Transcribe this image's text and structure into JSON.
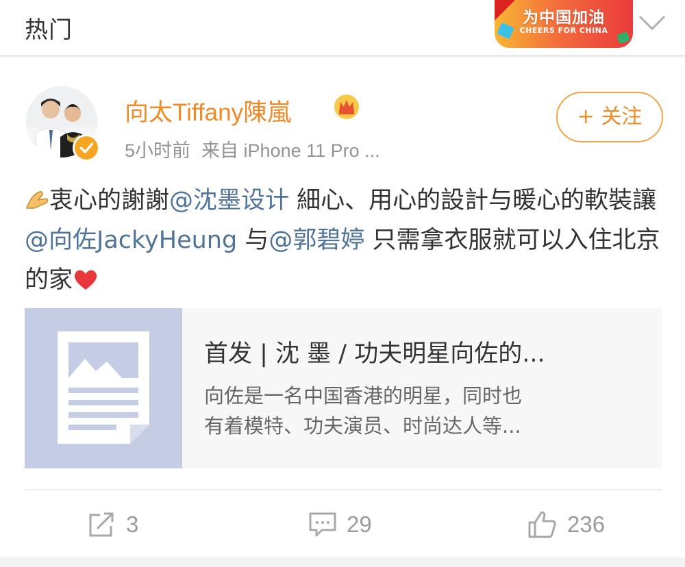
{
  "header": {
    "tab_title": "热门",
    "banner": {
      "main_text": "为中国加油",
      "sub_text": "CHEERS FOR CHINA"
    },
    "dropdown_icon": "chevron-down-icon"
  },
  "post": {
    "author": "向太Tiffany陳嵐",
    "badge_icon": "crown-icon",
    "time": "5小时前",
    "source": "来自 iPhone 11 Pro ...",
    "follow_label": "+ 关注",
    "text": {
      "part1": "衷心的謝謝",
      "mention1": "@沈墨设计",
      "part2": " 細心、用心的設計与暖心的軟裝讓",
      "mention2": "@向佐JackyHeung",
      "part3": " 与",
      "mention3": "@郭碧婷",
      "part4": " 只需拿衣服就可以入住北京的家"
    },
    "link_card": {
      "title": "首发 | 沈 墨 / 功夫明星向佐的...",
      "desc_line1": "向佐是一名中国香港的明星，同时也",
      "desc_line2": "有着模特、功夫演员、时尚达人等..."
    },
    "actions": {
      "repost_count": "3",
      "comment_count": "29",
      "like_count": "236"
    }
  },
  "colors": {
    "accent_orange": "#f08a26",
    "mention_blue": "#50739a",
    "meta_gray": "#939393"
  }
}
